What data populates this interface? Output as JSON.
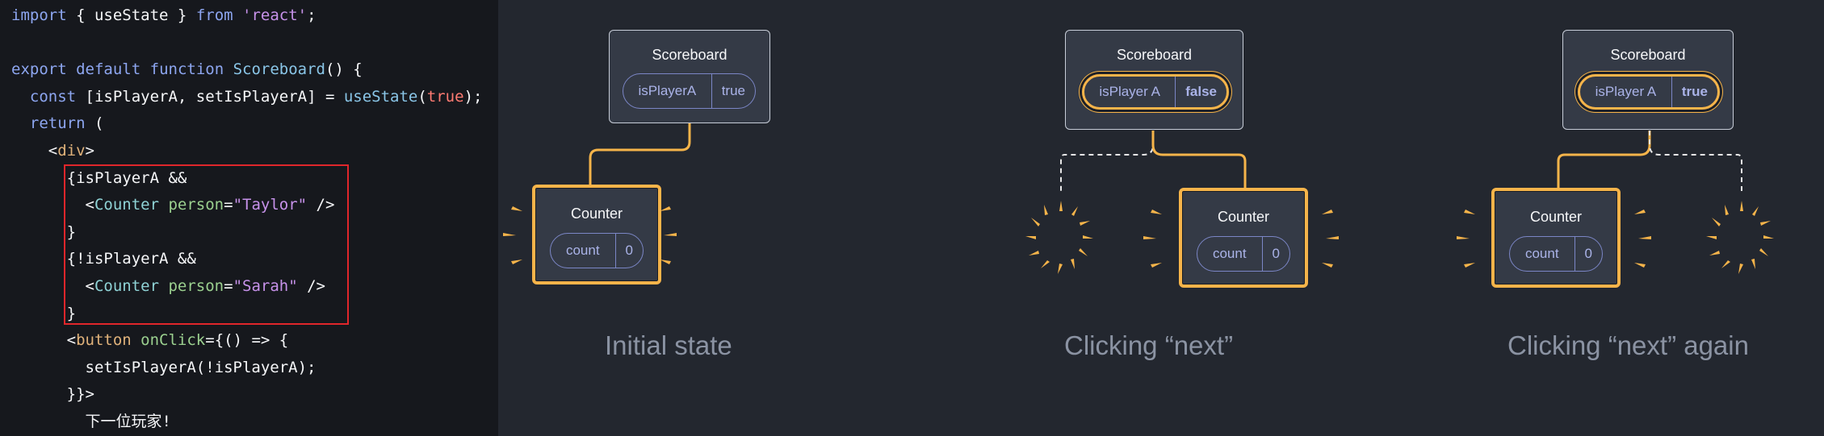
{
  "code": {
    "lines": [
      [
        {
          "t": "import",
          "c": "kw"
        },
        {
          "t": " { ",
          "c": "plain"
        },
        {
          "t": "useState",
          "c": "plain"
        },
        {
          "t": " } ",
          "c": "plain"
        },
        {
          "t": "from",
          "c": "kw"
        },
        {
          "t": " ",
          "c": "plain"
        },
        {
          "t": "'react'",
          "c": "str"
        },
        {
          "t": ";",
          "c": "plain"
        }
      ],
      [],
      [
        {
          "t": "export",
          "c": "kw"
        },
        {
          "t": " ",
          "c": "plain"
        },
        {
          "t": "default",
          "c": "kw"
        },
        {
          "t": " ",
          "c": "plain"
        },
        {
          "t": "function",
          "c": "kw"
        },
        {
          "t": " ",
          "c": "plain"
        },
        {
          "t": "Scoreboard",
          "c": "fn"
        },
        {
          "t": "() {",
          "c": "plain"
        }
      ],
      [
        {
          "t": "  ",
          "c": "plain"
        },
        {
          "t": "const",
          "c": "kw"
        },
        {
          "t": " [isPlayerA, setIsPlayerA] = ",
          "c": "plain"
        },
        {
          "t": "useState",
          "c": "fn"
        },
        {
          "t": "(",
          "c": "plain"
        },
        {
          "t": "true",
          "c": "bool"
        },
        {
          "t": ");",
          "c": "plain"
        }
      ],
      [
        {
          "t": "  ",
          "c": "plain"
        },
        {
          "t": "return",
          "c": "kw"
        },
        {
          "t": " (",
          "c": "plain"
        }
      ],
      [
        {
          "t": "    <",
          "c": "plain"
        },
        {
          "t": "div",
          "c": "tag"
        },
        {
          "t": ">",
          "c": "plain"
        }
      ],
      [
        {
          "t": "      {isPlayerA &&",
          "c": "plain"
        }
      ],
      [
        {
          "t": "        <",
          "c": "plain"
        },
        {
          "t": "Counter",
          "c": "comp"
        },
        {
          "t": " ",
          "c": "plain"
        },
        {
          "t": "person",
          "c": "attr"
        },
        {
          "t": "=",
          "c": "plain"
        },
        {
          "t": "\"Taylor\"",
          "c": "str"
        },
        {
          "t": " />",
          "c": "plain"
        }
      ],
      [
        {
          "t": "      }",
          "c": "plain"
        }
      ],
      [
        {
          "t": "      {!isPlayerA &&",
          "c": "plain"
        }
      ],
      [
        {
          "t": "        <",
          "c": "plain"
        },
        {
          "t": "Counter",
          "c": "comp"
        },
        {
          "t": " ",
          "c": "plain"
        },
        {
          "t": "person",
          "c": "attr"
        },
        {
          "t": "=",
          "c": "plain"
        },
        {
          "t": "\"Sarah\"",
          "c": "str"
        },
        {
          "t": " />",
          "c": "plain"
        }
      ],
      [
        {
          "t": "      }",
          "c": "plain"
        }
      ],
      [
        {
          "t": "      <",
          "c": "plain"
        },
        {
          "t": "button",
          "c": "tag"
        },
        {
          "t": " ",
          "c": "plain"
        },
        {
          "t": "onClick",
          "c": "attr"
        },
        {
          "t": "={() => {",
          "c": "plain"
        }
      ],
      [
        {
          "t": "        setIsPlayerA(!isPlayerA);",
          "c": "plain"
        }
      ],
      [
        {
          "t": "      }}>",
          "c": "plain"
        }
      ],
      [
        {
          "t": "        下一位玩家!",
          "c": "plain"
        }
      ]
    ]
  },
  "diagrams": [
    {
      "caption": "Initial state",
      "parent": {
        "title": "Scoreboard",
        "key": "isPlayerA",
        "value": "true",
        "changed": false
      },
      "child": {
        "title": "Counter",
        "key": "count",
        "value": "0"
      }
    },
    {
      "caption": "Clicking “next”",
      "parent": {
        "title": "Scoreboard",
        "key": "isPlayer A",
        "value": "false",
        "changed": true
      },
      "child": {
        "title": "Counter",
        "key": "count",
        "value": "0"
      }
    },
    {
      "caption": "Clicking “next” again",
      "parent": {
        "title": "Scoreboard",
        "key": "isPlayer A",
        "value": "true",
        "changed": true
      },
      "child": {
        "title": "Counter",
        "key": "count",
        "value": "0"
      }
    }
  ],
  "colors": {
    "accent": "#f6b44a",
    "highlight_border": "#e0262b",
    "caption": "#8b93a3"
  }
}
